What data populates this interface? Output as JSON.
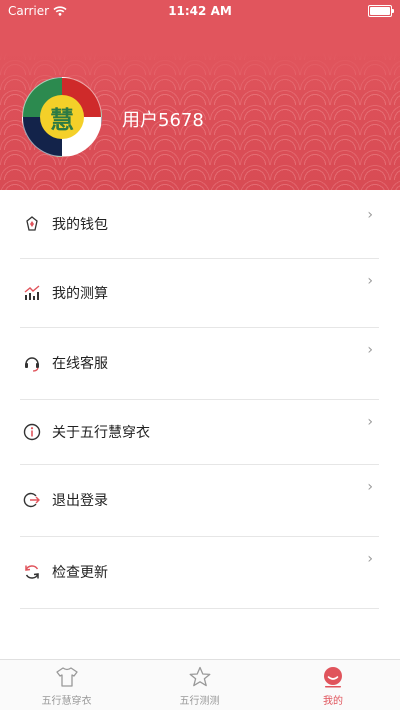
{
  "status": {
    "carrier": "Carrier",
    "time": "11:42 AM"
  },
  "profile": {
    "avatar_char": "慧",
    "username": "用户5678"
  },
  "menu": [
    {
      "label": "我的钱包",
      "icon": "wallet-icon"
    },
    {
      "label": "我的测算",
      "icon": "chart-trend-icon"
    },
    {
      "label": "在线客服",
      "icon": "headset-icon"
    },
    {
      "label": "关于五行慧穿衣",
      "icon": "info-icon"
    },
    {
      "label": "退出登录",
      "icon": "logout-icon"
    },
    {
      "label": "检查更新",
      "icon": "refresh-icon"
    }
  ],
  "chevron": "›",
  "tabs": [
    {
      "label": "五行慧穿衣",
      "icon": "shirt-icon"
    },
    {
      "label": "五行测测",
      "icon": "star-icon"
    },
    {
      "label": "我的",
      "icon": "face-icon"
    }
  ],
  "colors": {
    "accent": "#e0545c",
    "chevron": "#999999",
    "divider": "#e6e6e6"
  }
}
